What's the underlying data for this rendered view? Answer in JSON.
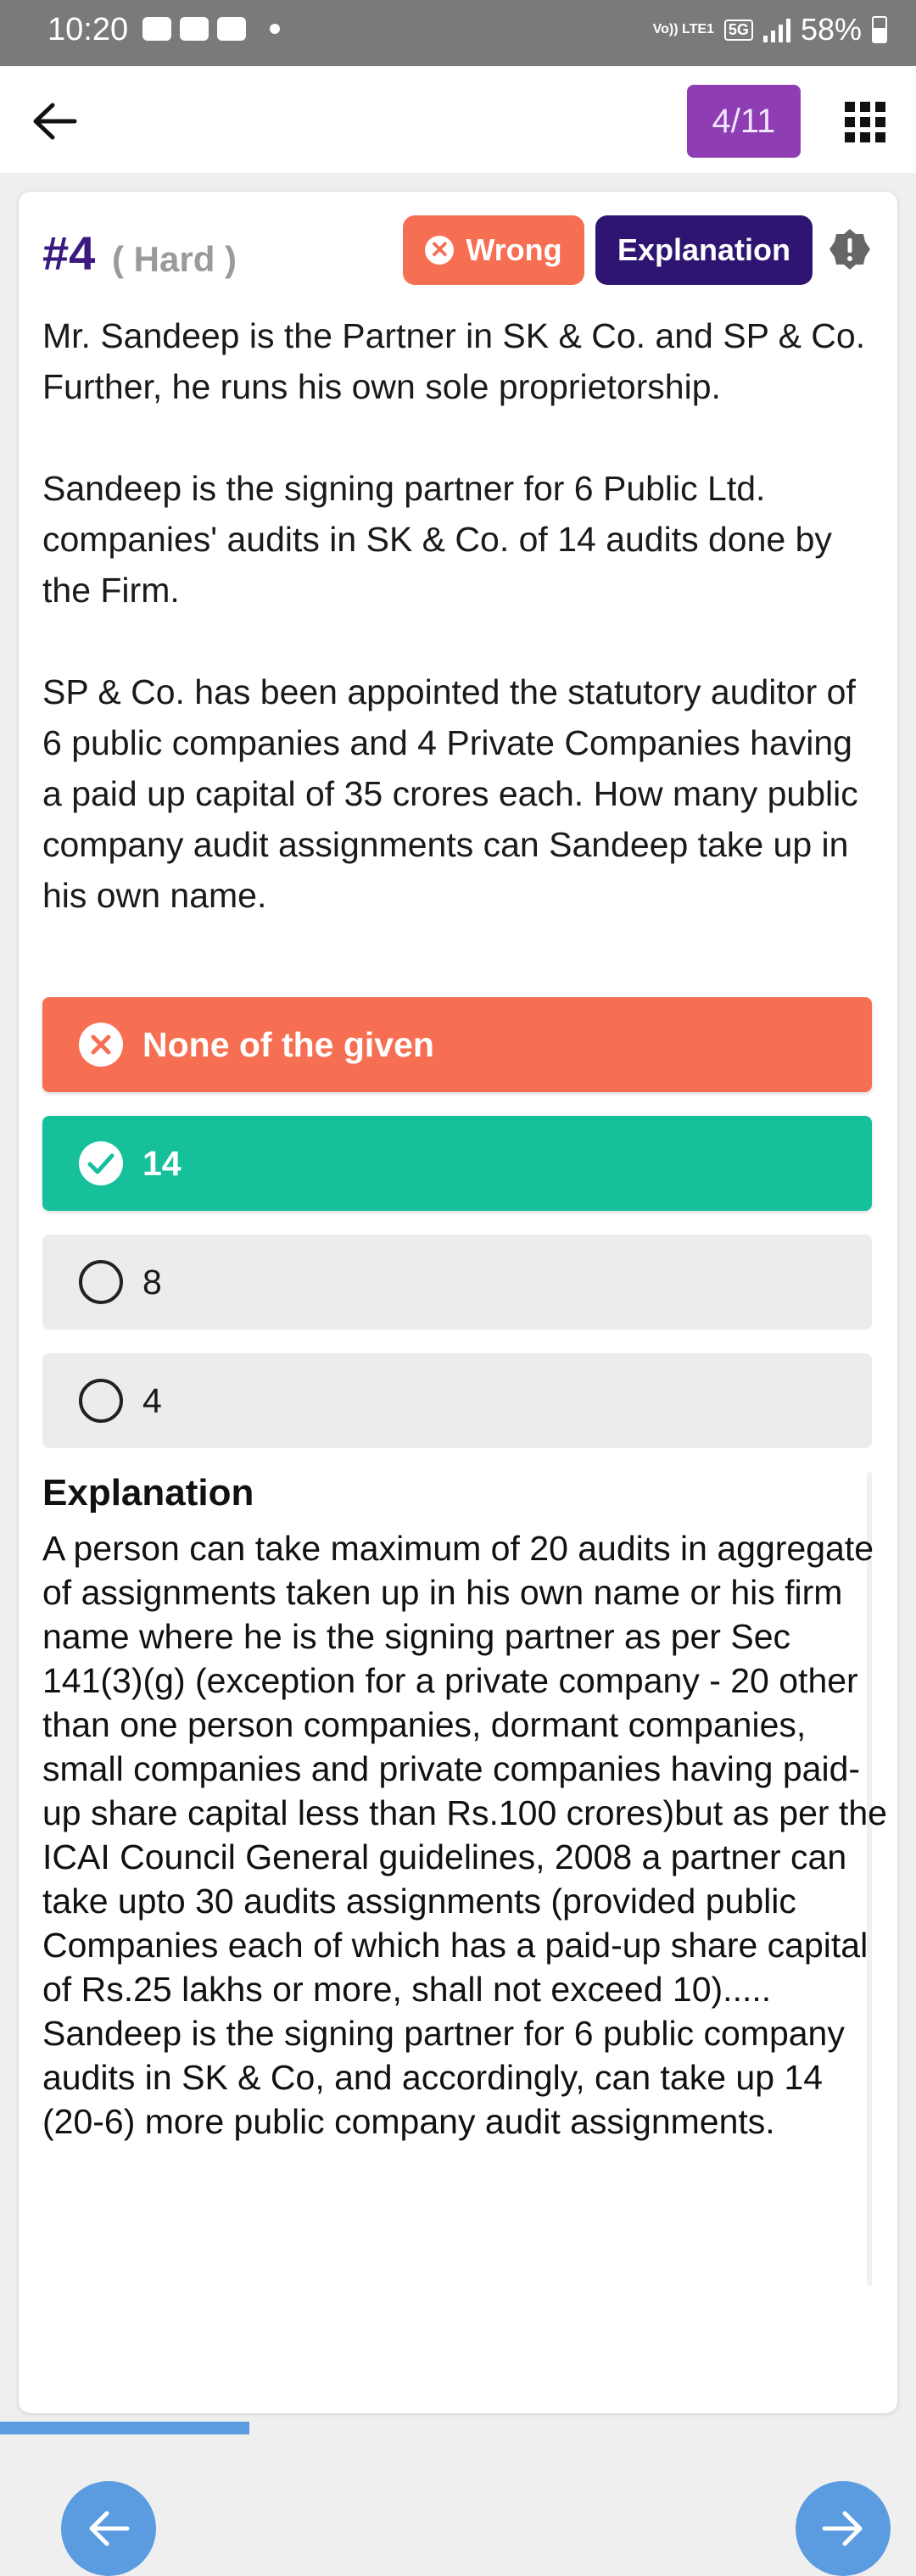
{
  "status_bar": {
    "time": "10:20",
    "network": "Vo)) LTE1",
    "fiveg": "5G",
    "battery": "58%"
  },
  "header": {
    "counter": "4/11"
  },
  "question": {
    "number": "#4",
    "difficulty": "( Hard )",
    "result_label": "Wrong",
    "explanation_button": "Explanation",
    "paragraphs": [
      "Mr. Sandeep is the Partner in SK & Co. and SP & Co. Further, he runs his own sole proprietorship.",
      "Sandeep is the signing partner for 6 Public Ltd. companies' audits in SK & Co. of 14 audits done by the Firm.",
      "SP & Co. has been appointed the statutory auditor of 6 public companies and 4 Private Companies having a paid up capital of 35 crores each. How many public company audit assignments can Sandeep take up in his own name."
    ]
  },
  "options": [
    {
      "label": "None of the given",
      "state": "wrong"
    },
    {
      "label": "14",
      "state": "correct"
    },
    {
      "label": "8",
      "state": "unselected"
    },
    {
      "label": "4",
      "state": "unselected"
    }
  ],
  "explanation": {
    "title": "Explanation",
    "body": "A person can take maximum of 20 audits in aggregate of assignments taken up in his own name or his firm name where he is the signing partner as per Sec 141(3)(g) (exception for a private company - 20 other than one person companies, dormant companies, small companies and private companies having paid-up share capital less than Rs.100 crores)but as per the ICAI Council General guidelines, 2008 a partner can take upto 30 audits assignments (provided public Companies each of which has a paid-up share capital of Rs.25 lakhs or more, shall not exceed 10).....  Sandeep is the signing partner for 6 public company audits in SK & Co, and accordingly, can take up 14 (20-6) more public company audit assignments."
  },
  "colors": {
    "wrong": "#f66f53",
    "correct": "#16c09a",
    "accent": "#2e1572",
    "counter": "#8e3db3",
    "nav": "#5b9be0"
  }
}
